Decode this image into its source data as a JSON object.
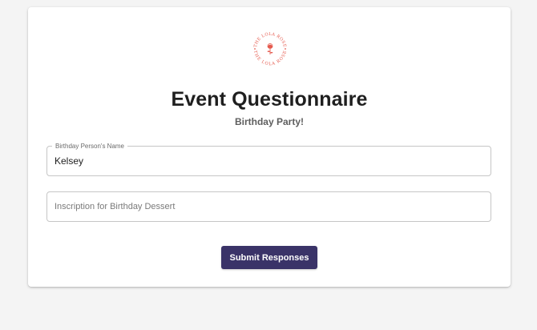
{
  "logo": {
    "name": "the-lola-rose-logo",
    "text": "THE LOLA ROSE",
    "color": "#e55a4e"
  },
  "form": {
    "title": "Event Questionnaire",
    "subtitle": "Birthday Party!",
    "fields": [
      {
        "label": "Birthday Person's Name",
        "value": "Kelsey"
      },
      {
        "placeholder": "Inscription for Birthday Dessert",
        "value": ""
      }
    ],
    "submit_label": "Submit Responses"
  },
  "colors": {
    "accent": "#3a3368",
    "page_background": "#f4f4f4",
    "card_background": "#ffffff",
    "logo": "#e55a4e"
  }
}
